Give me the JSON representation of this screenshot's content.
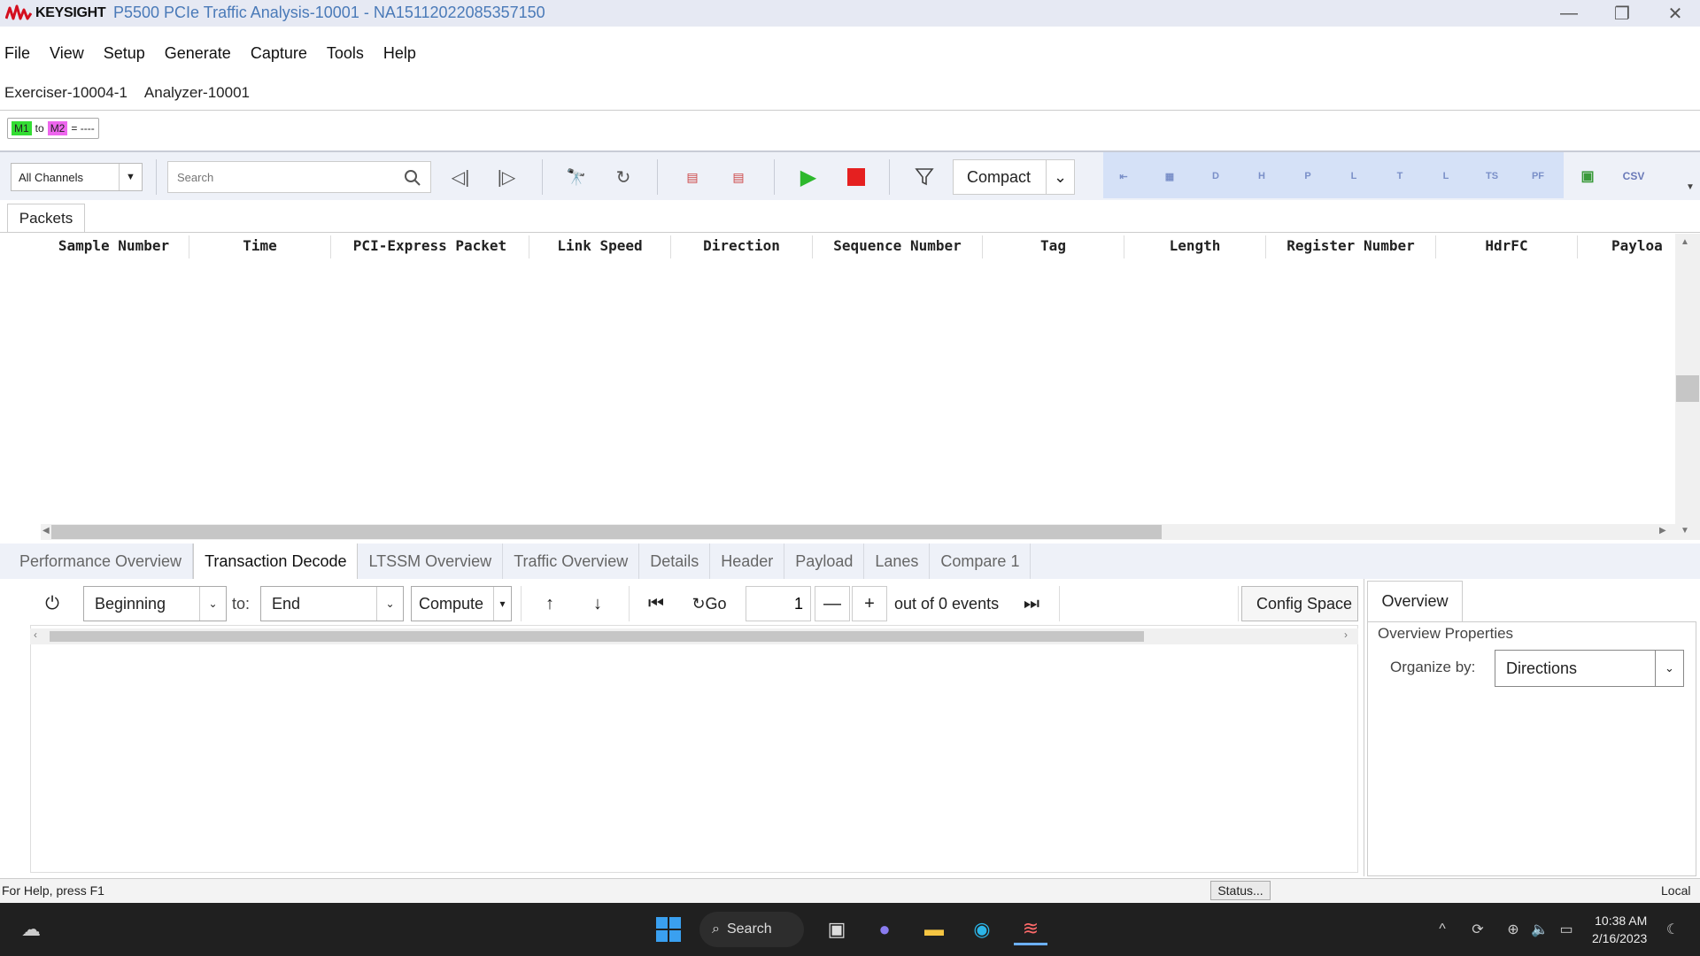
{
  "titlebar": {
    "brand": "KEYSIGHT",
    "title": "P5500 PCIe Traffic Analysis-10001 - NA15112022085357150",
    "brand_color": "#d40f1f",
    "title_color": "#4a7ab8",
    "controls": {
      "minimize": "—",
      "restore": "❐",
      "close": "✕"
    }
  },
  "menubar": [
    "File",
    "View",
    "Setup",
    "Generate",
    "Capture",
    "Tools",
    "Help"
  ],
  "device_tabs": [
    "Exerciser-10004-1",
    "Analyzer-10001"
  ],
  "marker": {
    "m1": "M1",
    "to": "to",
    "m2": "M2",
    "value": "= ----"
  },
  "toolbar": {
    "channel_select": "All Channels",
    "search_placeholder": "Search",
    "view_mode": "Compact",
    "csv_label": "CSV",
    "blue_icons": [
      "⇤",
      "▦",
      "D",
      "H",
      "P",
      "L",
      "T",
      "L",
      "TS",
      "PF",
      "▣"
    ]
  },
  "packets": {
    "tab_label": "Packets",
    "columns": [
      "Sample Number",
      "Time",
      "PCI-Express Packet",
      "Link Speed",
      "Direction",
      "Sequence Number",
      "Tag",
      "Length",
      "Register Number",
      "HdrFC",
      "Payloa"
    ]
  },
  "analysis_tabs": [
    {
      "label": "Performance Overview",
      "active": false
    },
    {
      "label": "Transaction Decode",
      "active": true
    },
    {
      "label": "LTSSM Overview",
      "active": false
    },
    {
      "label": "Traffic Overview",
      "active": false
    },
    {
      "label": "Details",
      "active": false
    },
    {
      "label": "Header",
      "active": false
    },
    {
      "label": "Payload",
      "active": false
    },
    {
      "label": "Lanes",
      "active": false
    },
    {
      "label": "Compare 1",
      "active": false
    }
  ],
  "decode": {
    "from": "Beginning",
    "to_label": "to:",
    "to": "End",
    "compute": "Compute",
    "go": "Go",
    "page": "1",
    "events": "out of 0 events",
    "config_space": "Config Space S"
  },
  "overview": {
    "tab": "Overview",
    "title": "Overview Properties",
    "organize_label": "Organize by:",
    "organize_value": "Directions"
  },
  "statusbar": {
    "help": "For Help, press F1",
    "status": "Status...",
    "mode": "Local"
  },
  "taskbar": {
    "search": "Search",
    "time": "10:38 AM",
    "date": "2/16/2023"
  }
}
